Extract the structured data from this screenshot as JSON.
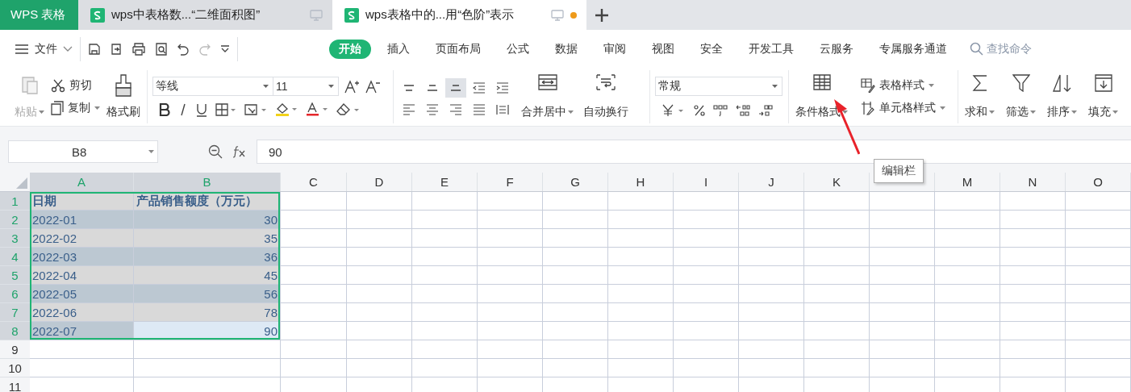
{
  "app_tab": {
    "label": "WPS 表格"
  },
  "doc_tabs": [
    {
      "title": "wps中表格数...“二维面积图”",
      "selected": false,
      "unsaved": false
    },
    {
      "title": "wps表格中的...用“色阶”表示",
      "selected": true,
      "unsaved": true
    }
  ],
  "file_menu": {
    "label": "文件"
  },
  "menu_tabs": [
    {
      "label": "开始",
      "selected": true
    },
    {
      "label": "插入",
      "selected": false
    },
    {
      "label": "页面布局",
      "selected": false
    },
    {
      "label": "公式",
      "selected": false
    },
    {
      "label": "数据",
      "selected": false
    },
    {
      "label": "审阅",
      "selected": false
    },
    {
      "label": "视图",
      "selected": false
    },
    {
      "label": "安全",
      "selected": false
    },
    {
      "label": "开发工具",
      "selected": false
    },
    {
      "label": "云服务",
      "selected": false
    },
    {
      "label": "专属服务通道",
      "selected": false
    }
  ],
  "search": {
    "placeholder": "查找命令"
  },
  "clipboard": {
    "paste": {
      "label": "粘贴",
      "disabled": true
    },
    "cut": "剪切",
    "copy": "复制",
    "format_painter": "格式刷"
  },
  "font": {
    "name": "等线",
    "size": "11"
  },
  "vertical_align": [
    {
      "selected": false
    },
    {
      "selected": false
    },
    {
      "selected": true
    }
  ],
  "merge": "合并居中",
  "wrap": "自动换行",
  "number_format": "常规",
  "styles": [
    "条件格式",
    "表格样式",
    "单元格样式"
  ],
  "editing": [
    "求和",
    "筛选",
    "排序",
    "填充"
  ],
  "formula_bar": {
    "name_box": "B8",
    "value": "90"
  },
  "tooltip": {
    "label": "编辑栏"
  },
  "columns": [
    {
      "label": "A",
      "selected": true
    },
    {
      "label": "B",
      "selected": true
    },
    {
      "label": "C",
      "selected": false
    },
    {
      "label": "D",
      "selected": false
    },
    {
      "label": "E",
      "selected": false
    },
    {
      "label": "F",
      "selected": false
    },
    {
      "label": "G",
      "selected": false
    },
    {
      "label": "H",
      "selected": false
    },
    {
      "label": "I",
      "selected": false
    },
    {
      "label": "J",
      "selected": false
    },
    {
      "label": "K",
      "selected": false
    },
    {
      "selected": false
    },
    {
      "label": "M",
      "selected": false
    },
    {
      "label": "N",
      "selected": false
    },
    {
      "label": "O",
      "selected": false
    }
  ],
  "rows": [
    {
      "number": "1",
      "selected": true,
      "kind": "header",
      "cells": [
        {
          "text": "日期",
          "color": "#d9d9d9"
        },
        {
          "text": "产品销售额度（万元）",
          "color": "#d9d9d9"
        }
      ]
    },
    {
      "number": "2",
      "selected": true,
      "kind": "data",
      "cells": [
        {
          "text": "2022-01",
          "color": "#bcc8d2"
        },
        {
          "text": "30",
          "color": "#bcc8d2"
        }
      ]
    },
    {
      "number": "3",
      "selected": true,
      "kind": "data",
      "cells": [
        {
          "text": "2022-02",
          "color": "#d9d9d9"
        },
        {
          "text": "35",
          "color": "#d9d9d9"
        }
      ]
    },
    {
      "number": "4",
      "selected": true,
      "kind": "data",
      "cells": [
        {
          "text": "2022-03",
          "color": "#bcc8d2"
        },
        {
          "text": "36",
          "color": "#bcc8d2"
        }
      ]
    },
    {
      "number": "5",
      "selected": true,
      "kind": "data",
      "cells": [
        {
          "text": "2022-04",
          "color": "#d9d9d9"
        },
        {
          "text": "45",
          "color": "#d9d9d9"
        }
      ]
    },
    {
      "number": "6",
      "selected": true,
      "kind": "data",
      "cells": [
        {
          "text": "2022-05",
          "color": "#bcc8d2"
        },
        {
          "text": "56",
          "color": "#bcc8d2"
        }
      ]
    },
    {
      "number": "7",
      "selected": true,
      "kind": "data",
      "cells": [
        {
          "text": "2022-06",
          "color": "#d9d9d9"
        },
        {
          "text": "78",
          "color": "#d9d9d9"
        }
      ]
    },
    {
      "number": "8",
      "selected": true,
      "kind": "data",
      "cells": [
        {
          "text": "2022-07",
          "color": "#bcc8d2"
        },
        {
          "text": "90",
          "color": "#dde9f5"
        }
      ]
    },
    {
      "number": "9",
      "selected": false,
      "cells": []
    },
    {
      "number": "10",
      "selected": false,
      "cells": []
    },
    {
      "number": "11",
      "selected": false,
      "cells": []
    }
  ]
}
